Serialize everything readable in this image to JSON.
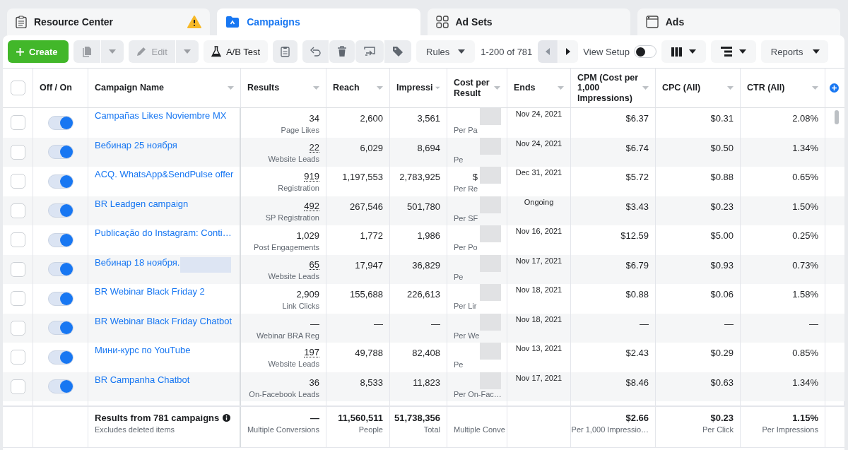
{
  "tabs": [
    {
      "label": "Resource Center",
      "selected": false,
      "warning": true
    },
    {
      "label": "Campaigns",
      "selected": true,
      "warning": false
    },
    {
      "label": "Ad Sets",
      "selected": false,
      "warning": false
    },
    {
      "label": "Ads",
      "selected": false,
      "warning": false
    }
  ],
  "toolbar": {
    "create": {
      "label": "Create"
    },
    "duplicate": {
      "disabled": true
    },
    "edit": {
      "label": "Edit",
      "disabled": true
    },
    "ab_test": {
      "label": "A/B Test"
    },
    "rules": {
      "label": "Rules"
    },
    "pagination": "1-200 of 781",
    "view_setup": {
      "label": "View Setup",
      "on": false
    },
    "reports": {
      "label": "Reports"
    }
  },
  "table": {
    "header_checkbox": {
      "checked": false
    },
    "columns": [
      "Off / On",
      "Campaign Name",
      "Results",
      "Reach",
      "Impressi",
      "Cost per Result",
      "Ends",
      "CPM (Cost per 1,000 Impressions)",
      "CPC (All)",
      "CTR (All)"
    ],
    "rows": [
      {
        "checked": false,
        "on": true,
        "name": "Campañas Likes Noviembre MX",
        "name_redacted": false,
        "results": "34",
        "results_dotted": false,
        "result_type": "Page Likes",
        "reach": "2,600",
        "impressions": "3,561",
        "cost_per_result": "",
        "cost_label": "Per Pa",
        "ends": "Nov 24, 2021",
        "cpm": "$6.37",
        "cpc": "$0.31",
        "ctr": "2.08%"
      },
      {
        "checked": false,
        "on": true,
        "name": "Вебинар 25 ноября",
        "name_redacted": false,
        "results": "22",
        "results_dotted": true,
        "result_type": "Website Leads",
        "reach": "6,029",
        "impressions": "8,694",
        "cost_per_result": "",
        "cost_label": "Pe",
        "ends": "Nov 24, 2021",
        "cpm": "$6.74",
        "cpc": "$0.50",
        "ctr": "1.34%"
      },
      {
        "checked": false,
        "on": true,
        "name": "ACQ. WhatsApp&SendPulse offer",
        "name_redacted": false,
        "results": "919",
        "results_dotted": true,
        "result_type": "Registration",
        "reach": "1,197,553",
        "impressions": "2,783,925",
        "cost_per_result": "$",
        "cost_label": "Per Re",
        "ends": "Dec 31, 2021",
        "cpm": "$5.72",
        "cpc": "$0.88",
        "ctr": "0.65%"
      },
      {
        "checked": false,
        "on": true,
        "name": "BR Leadgen campaign",
        "name_redacted": false,
        "results": "492",
        "results_dotted": true,
        "result_type": "SP Registration",
        "reach": "267,546",
        "impressions": "501,780",
        "cost_per_result": "",
        "cost_label": "Per SF",
        "ends": "Ongoing",
        "cpm": "$3.43",
        "cpc": "$0.23",
        "ctr": "1.50%"
      },
      {
        "checked": false,
        "on": true,
        "name": "Publicação do Instagram: Conti…",
        "name_redacted": false,
        "results": "1,029",
        "results_dotted": false,
        "result_type": "Post Engagements",
        "reach": "1,772",
        "impressions": "1,986",
        "cost_per_result": "",
        "cost_label": "Per Po",
        "ends": "Nov 16, 2021",
        "cpm": "$12.59",
        "cpc": "$5.00",
        "ctr": "0.25%"
      },
      {
        "checked": false,
        "on": true,
        "name": "Вебинар 18 ноября.",
        "name_redacted": true,
        "results": "65",
        "results_dotted": true,
        "result_type": "Website Leads",
        "reach": "17,947",
        "impressions": "36,829",
        "cost_per_result": "",
        "cost_label": "Pe",
        "ends": "Nov 17, 2021",
        "cpm": "$6.79",
        "cpc": "$0.93",
        "ctr": "0.73%"
      },
      {
        "checked": false,
        "on": true,
        "name": "BR Webinar Black Friday 2",
        "name_redacted": false,
        "results": "2,909",
        "results_dotted": false,
        "result_type": "Link Clicks",
        "reach": "155,688",
        "impressions": "226,613",
        "cost_per_result": "",
        "cost_label": "Per Lir",
        "ends": "Nov 18, 2021",
        "cpm": "$0.88",
        "cpc": "$0.06",
        "ctr": "1.58%"
      },
      {
        "checked": false,
        "on": true,
        "name": "BR Webinar Black Friday Chatbot",
        "name_redacted": false,
        "results": "—",
        "results_dotted": false,
        "result_type": "Webinar BRA Reg",
        "reach": "—",
        "impressions": "—",
        "cost_per_result": "",
        "cost_label": "Per We",
        "ends": "Nov 18, 2021",
        "cpm": "—",
        "cpc": "—",
        "ctr": "—"
      },
      {
        "checked": false,
        "on": true,
        "name": "Мини-курс по YouTube",
        "name_redacted": false,
        "results": "197",
        "results_dotted": true,
        "result_type": "Website Leads",
        "reach": "49,788",
        "impressions": "82,408",
        "cost_per_result": "",
        "cost_label": "Pe",
        "ends": "Nov 13, 2021",
        "cpm": "$2.43",
        "cpc": "$0.29",
        "ctr": "0.85%"
      },
      {
        "checked": false,
        "on": true,
        "name": "BR Campanha Chatbot",
        "name_redacted": false,
        "results": "36",
        "results_dotted": false,
        "result_type": "On-Facebook Leads",
        "reach": "8,533",
        "impressions": "11,823",
        "cost_per_result": "",
        "cost_label": "Per On-Fac…",
        "ends": "Nov 17, 2021",
        "cpm": "$8.46",
        "cpc": "$0.63",
        "ctr": "1.34%"
      }
    ],
    "footer": {
      "title": "Results from 781 campaigns",
      "subtitle": "Excludes deleted items",
      "results": "—",
      "results_label": "Multiple Conversions",
      "reach": "11,560,511",
      "reach_label": "People",
      "impressions": "51,738,356",
      "impressions_label": "Total",
      "cost_label": "Multiple Conve",
      "cpm": "$2.66",
      "cpm_label": "Per 1,000 Impressio…",
      "cpc": "$0.23",
      "cpc_label": "Per Click",
      "ctr": "1.15%",
      "ctr_label": "Per Impressions"
    }
  }
}
